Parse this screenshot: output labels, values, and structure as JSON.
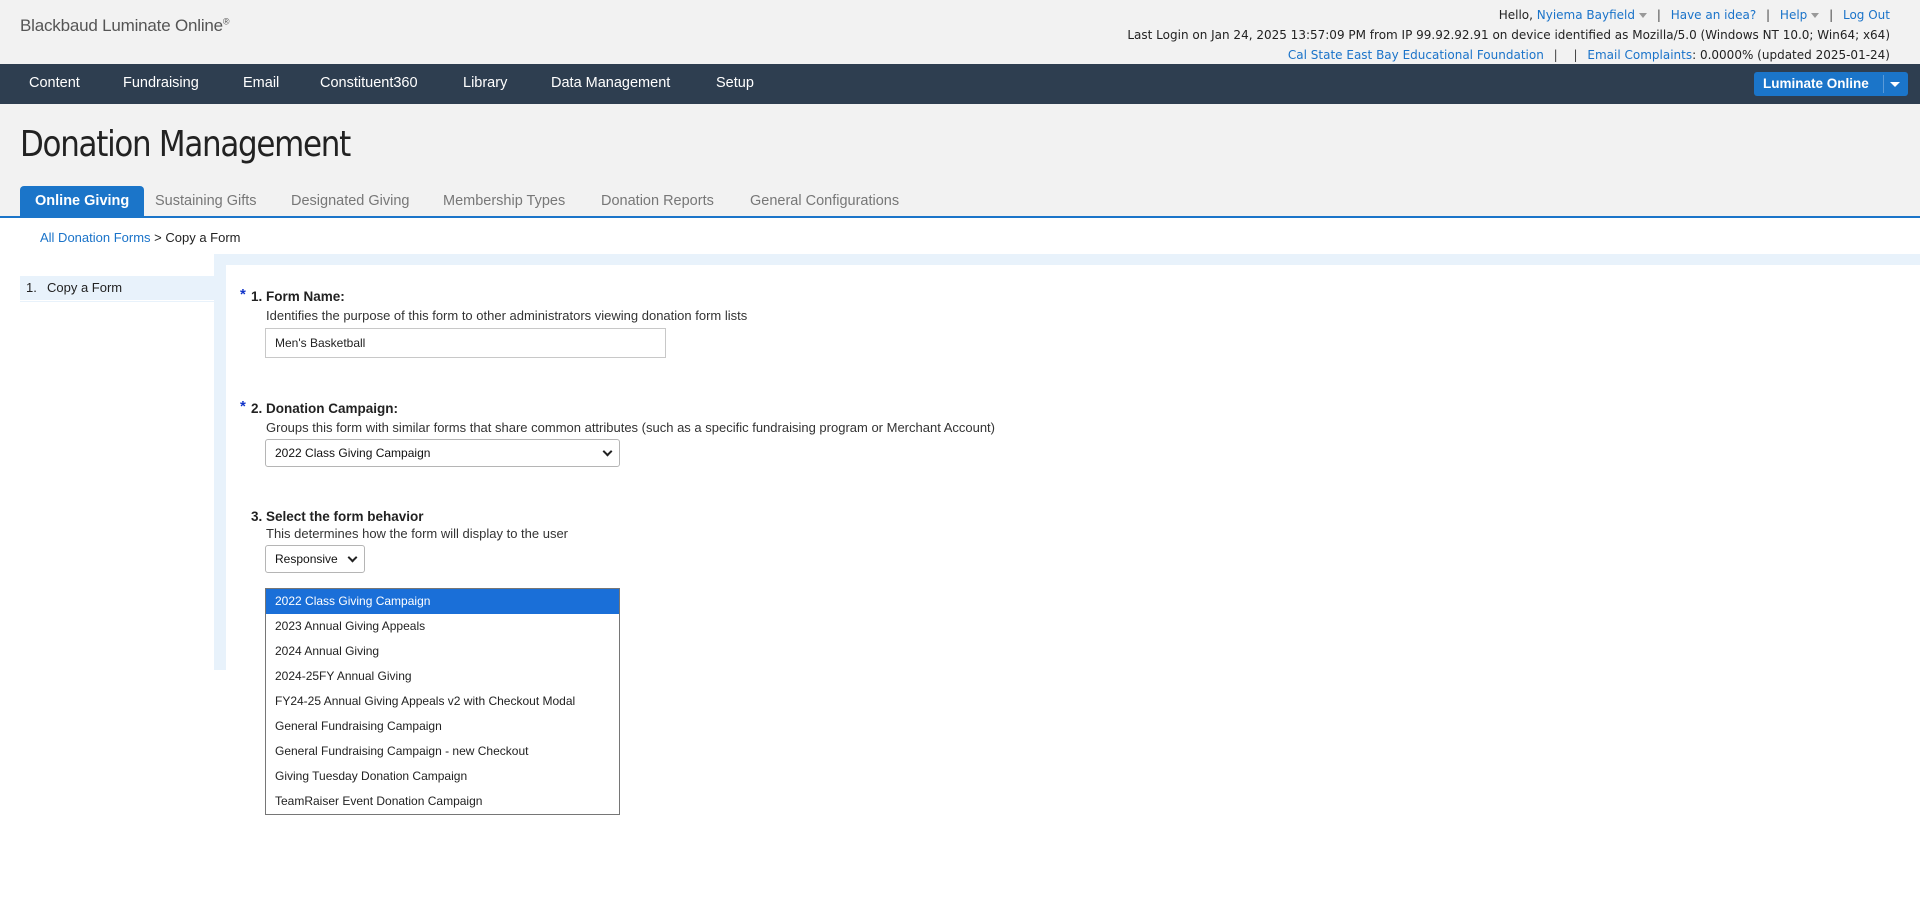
{
  "header": {
    "logo_text": "Blackbaud Luminate Online",
    "logo_mark": "®",
    "hello_prefix": "Hello,",
    "user_name": "Nyiema Bayfield",
    "have_idea": "Have an idea?",
    "help": "Help",
    "logout": "Log Out",
    "separator": "|",
    "last_login": "Last Login on Jan 24, 2025 13:57:09 PM from IP 99.92.92.91 on device identified as Mozilla/5.0 (Windows NT 10.0; Win64; x64)",
    "org_link": "Cal State East Bay Educational Foundation",
    "email_complaints_label": "Email Complaints",
    "email_complaints_value": ": 0.0000% (updated 2025-01-24)"
  },
  "nav": {
    "items": [
      "Content",
      "Fundraising",
      "Email",
      "Constituent360",
      "Library",
      "Data Management",
      "Setup"
    ],
    "product_button": "Luminate Online"
  },
  "page": {
    "title": "Donation Management"
  },
  "tabs": {
    "items": [
      "Online Giving",
      "Sustaining Gifts",
      "Designated Giving",
      "Membership Types",
      "Donation Reports",
      "General Configurations"
    ],
    "active_index": 0
  },
  "breadcrumb": {
    "link": "All Donation Forms",
    "current": " > Copy a Form"
  },
  "steps": {
    "items": [
      {
        "number": "1.",
        "label": "Copy a Form"
      }
    ]
  },
  "form": {
    "required_mark": "*",
    "field1": {
      "label": "1. Form Name:",
      "help": "Identifies the purpose of this form to other administrators viewing donation form lists",
      "value": "Men's Basketball"
    },
    "field2": {
      "label": "2. Donation Campaign:",
      "help": "Groups this form with similar forms that share common attributes (such as a specific fundraising program or Merchant Account)",
      "value": "2022 Class Giving Campaign"
    },
    "field3": {
      "label": "3. Select the form behavior",
      "help": "This determines how the form will display to the user",
      "value": "Responsive"
    }
  },
  "campaign_options": {
    "items": [
      "2022 Class Giving Campaign",
      "2023 Annual Giving Appeals",
      "2024 Annual Giving",
      "2024-25FY Annual Giving",
      "FY24-25 Annual Giving Appeals v2 with Checkout Modal",
      "General Fundraising Campaign",
      "General Fundraising Campaign - new Checkout",
      "Giving Tuesday Donation Campaign",
      "TeamRaiser Event Donation Campaign"
    ],
    "selected_index": 0
  },
  "colors": {
    "nav_bg": "#2e3e50",
    "accent": "#1b75c9",
    "link": "#1a73c9",
    "panel_bg": "#e8f2fb",
    "selected_option": "#1a6fd8"
  }
}
